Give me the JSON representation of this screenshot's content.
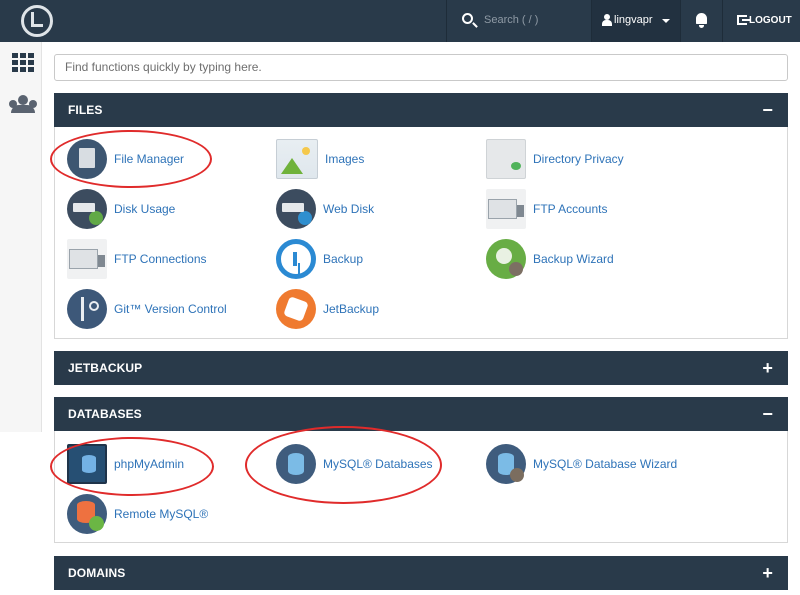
{
  "topbar": {
    "search_placeholder": "Search ( / )",
    "username": "lingvapr",
    "logout_label": "LOGOUT"
  },
  "quick_search": {
    "placeholder": "Find functions quickly by typing here."
  },
  "sections": {
    "files": {
      "title": "FILES",
      "toggle": "−",
      "items": [
        {
          "label": "File Manager",
          "icon": "file-manager-icon"
        },
        {
          "label": "Images",
          "icon": "images-icon"
        },
        {
          "label": "Directory Privacy",
          "icon": "directory-privacy-icon"
        },
        {
          "label": "Disk Usage",
          "icon": "disk-usage-icon"
        },
        {
          "label": "Web Disk",
          "icon": "web-disk-icon"
        },
        {
          "label": "FTP Accounts",
          "icon": "ftp-accounts-icon"
        },
        {
          "label": "FTP Connections",
          "icon": "ftp-connections-icon"
        },
        {
          "label": "Backup",
          "icon": "backup-icon"
        },
        {
          "label": "Backup Wizard",
          "icon": "backup-wizard-icon"
        },
        {
          "label": "Git™ Version Control",
          "icon": "git-icon"
        },
        {
          "label": "JetBackup",
          "icon": "jetbackup-icon"
        }
      ]
    },
    "jetbackup": {
      "title": "JETBACKUP",
      "toggle": "+"
    },
    "databases": {
      "title": "DATABASES",
      "toggle": "−",
      "items": [
        {
          "label": "phpMyAdmin",
          "icon": "phpmyadmin-icon"
        },
        {
          "label": "MySQL® Databases",
          "icon": "mysql-databases-icon"
        },
        {
          "label": "MySQL® Database Wizard",
          "icon": "mysql-database-wizard-icon"
        },
        {
          "label": "Remote MySQL®",
          "icon": "remote-mysql-icon"
        }
      ]
    },
    "domains": {
      "title": "DOMAINS",
      "toggle": "+"
    }
  },
  "colors": {
    "header_bg": "#293a4a",
    "link": "#2e73b8",
    "annotation": "#e02b2b"
  }
}
